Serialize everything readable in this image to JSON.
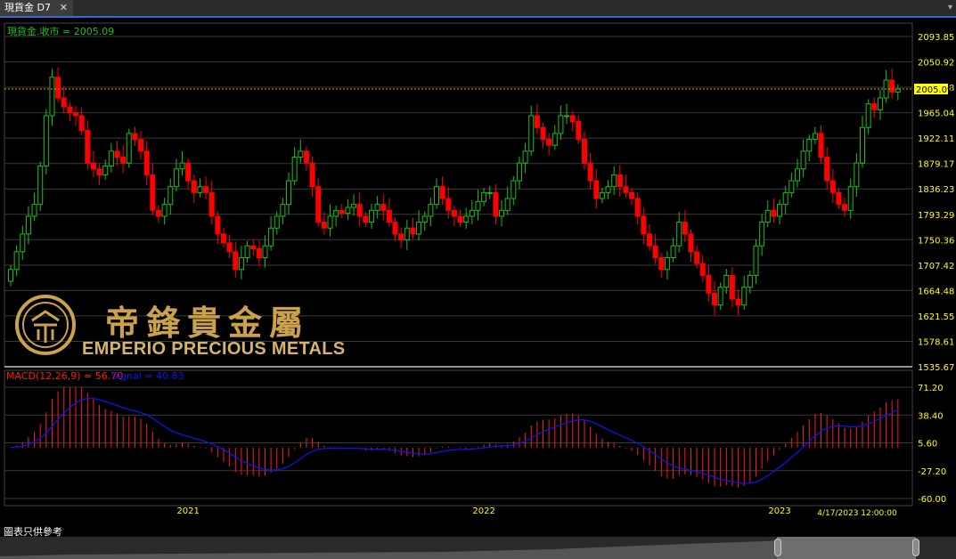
{
  "tab": {
    "title": "現貨金 D7",
    "close_glyph": "✕",
    "menu_glyph": "▾"
  },
  "colors": {
    "up": "#18c018",
    "down": "#ff0000",
    "macd": "#ff1a1a",
    "signal": "#1111ee",
    "grid": "#3a3a3a",
    "price_line": "#e8a000",
    "axis_text": "#ffff00"
  },
  "logo": {
    "cn": "帝鋒貴金屬",
    "en": "EMPERIO PRECIOUS METALS"
  },
  "footer": {
    "disclaimer": "圖表只供參考"
  },
  "chart_data": [
    {
      "type": "candlestick",
      "legend": "現貨金.收市 = 2005.09",
      "last_price": 2005.09,
      "last_price_label": "2005.09",
      "y_ticks": [
        "2093.85",
        "2050.92",
        "2007.98",
        "1965.04",
        "1922.11",
        "1879.17",
        "1836.23",
        "1793.29",
        "1750.36",
        "1707.42",
        "1664.48",
        "1621.55",
        "1578.61",
        "1535.67"
      ],
      "ylim": [
        1535.67,
        2093.85
      ],
      "grid": true,
      "close_values": [
        1700,
        1730,
        1760,
        1790,
        1810,
        1875,
        1960,
        2025,
        1990,
        1975,
        1965,
        1960,
        1935,
        1880,
        1870,
        1860,
        1875,
        1900,
        1890,
        1880,
        1930,
        1920,
        1900,
        1860,
        1800,
        1790,
        1810,
        1840,
        1870,
        1880,
        1850,
        1830,
        1840,
        1830,
        1790,
        1760,
        1745,
        1730,
        1700,
        1720,
        1740,
        1735,
        1720,
        1740,
        1770,
        1790,
        1810,
        1850,
        1890,
        1900,
        1880,
        1840,
        1780,
        1770,
        1790,
        1800,
        1795,
        1805,
        1810,
        1790,
        1780,
        1800,
        1810,
        1800,
        1780,
        1760,
        1750,
        1770,
        1760,
        1780,
        1790,
        1810,
        1840,
        1820,
        1800,
        1790,
        1780,
        1790,
        1800,
        1815,
        1830,
        1830,
        1790,
        1800,
        1820,
        1850,
        1880,
        1900,
        1960,
        1940,
        1920,
        1910,
        1930,
        1960,
        1960,
        1950,
        1920,
        1880,
        1850,
        1820,
        1830,
        1840,
        1860,
        1840,
        1830,
        1820,
        1790,
        1760,
        1740,
        1720,
        1700,
        1720,
        1740,
        1780,
        1760,
        1730,
        1710,
        1690,
        1660,
        1640,
        1670,
        1690,
        1650,
        1640,
        1670,
        1690,
        1740,
        1780,
        1800,
        1790,
        1810,
        1830,
        1850,
        1870,
        1900,
        1920,
        1930,
        1890,
        1850,
        1830,
        1810,
        1800,
        1840,
        1880,
        1940,
        1980,
        1970,
        1990,
        2020,
        2000,
        2005.09
      ],
      "macd_label": "MACD(12,26,9) = 56.70",
      "signal_label": "Signal = 40.83",
      "macd_y_ticks": [
        "71.20",
        "38.40",
        "5.60",
        "-27.20",
        "-60.00"
      ],
      "macd_ylim": [
        -60,
        71.2
      ],
      "x_ticks": [
        {
          "label": "2021",
          "index": 30
        },
        {
          "label": "2022",
          "index": 80
        },
        {
          "label": "2023",
          "index": 130
        }
      ],
      "last_date": "4/17/2023 12:00:00",
      "x_range": [
        0,
        144
      ]
    }
  ]
}
